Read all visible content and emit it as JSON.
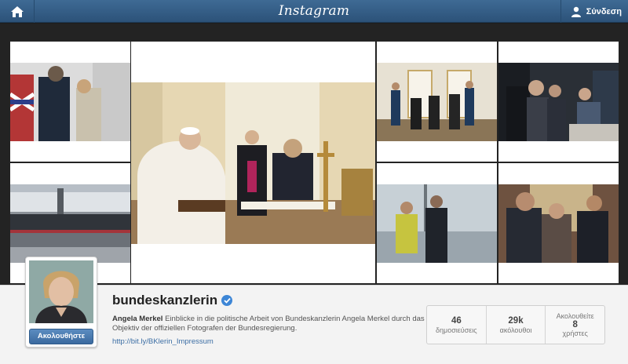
{
  "topbar": {
    "logo": "Instagram",
    "home_icon": "home-icon",
    "user_icon": "user-icon",
    "login_label": "Σύνδεση"
  },
  "grid": {
    "photos": [
      {
        "alt": "photo-1"
      },
      {
        "alt": "photo-2"
      },
      {
        "alt": "photo-3"
      },
      {
        "alt": "photo-4"
      },
      {
        "alt": "photo-5"
      },
      {
        "alt": "photo-6"
      },
      {
        "alt": "photo-7"
      },
      {
        "alt": "photo-8"
      }
    ]
  },
  "profile": {
    "follow_label": "Ακολουθήστε",
    "username": "bundeskanzlerin",
    "verified_icon": "verified-badge-icon",
    "full_name": "Angela Merkel",
    "bio": "Einblicke in die politische Arbeit von Bundeskanzlerin Angela Merkel durch das Objektiv der offiziellen Fotografen der Bundesregierung.",
    "link": "http://bit.ly/BKlerin_Impressum",
    "stats": {
      "posts_count": "46",
      "posts_label": "δημοσιεύσεις",
      "followers_count": "29k",
      "followers_label": "ακόλουθοι",
      "following_label": "Ακολουθείτε",
      "following_count": "8",
      "following_unit": "χρήστες"
    }
  },
  "colors": {
    "topbar": "#2c5279",
    "accent": "#3d86d6",
    "link": "#3d6fa5"
  }
}
